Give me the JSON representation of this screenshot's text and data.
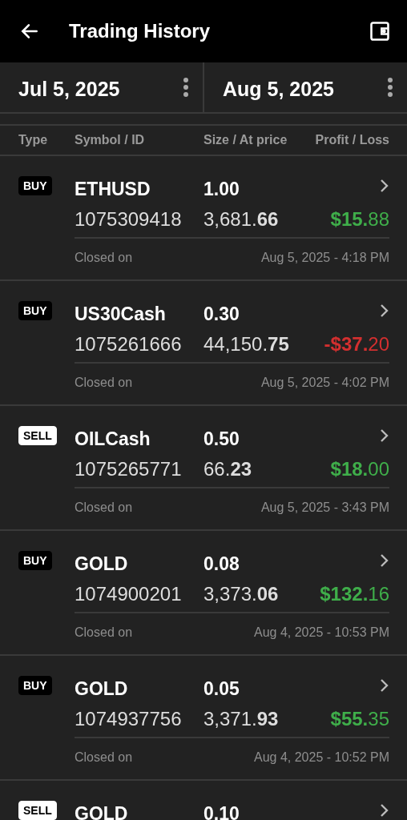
{
  "header": {
    "title": "Trading History"
  },
  "date_range": [
    {
      "value": "Jul 5, 2025"
    },
    {
      "value": "Aug 5, 2025"
    }
  ],
  "table": {
    "columns": [
      "Type",
      "Symbol / ID",
      "Size / At price",
      "Profit / Loss"
    ],
    "rows": [
      {
        "side": "BUY",
        "kind": "buy",
        "symbol": "ETHUSD",
        "size": "1.00",
        "id": "1075309418",
        "price": "3,681.**66**",
        "pnl": "**$15.**88",
        "color": "#3fae4a",
        "closed_label": "Closed on",
        "closed_at": "Aug 5, 2025 - 4:18 PM"
      },
      {
        "side": "BUY",
        "kind": "buy",
        "symbol": "US30Cash",
        "size": "0.30",
        "id": "1075261666",
        "price": "44,150.**75**",
        "pnl": "**-$37.**20",
        "color": "#d32f2f",
        "closed_label": "Closed on",
        "closed_at": "Aug 5, 2025 - 4:02 PM"
      },
      {
        "side": "SELL",
        "kind": "sell",
        "symbol": "OILCash",
        "size": "0.50",
        "id": "1075265771",
        "price": "66.**23**",
        "pnl": "**$18.**00",
        "color": "#3fae4a",
        "closed_label": "Closed on",
        "closed_at": "Aug 5, 2025 - 3:43 PM"
      },
      {
        "side": "BUY",
        "kind": "buy",
        "symbol": "GOLD",
        "size": "0.08",
        "id": "1074900201",
        "price": "3,373.**06**",
        "pnl": "**$132.**16",
        "color": "#3fae4a",
        "closed_label": "Closed on",
        "closed_at": "Aug 4, 2025 - 10:53 PM"
      },
      {
        "side": "BUY",
        "kind": "buy",
        "symbol": "GOLD",
        "size": "0.05",
        "id": "1074937756",
        "price": "3,371.**93**",
        "pnl": "**$55.**35",
        "color": "#3fae4a",
        "closed_label": "Closed on",
        "closed_at": "Aug 4, 2025 - 10:52 PM"
      },
      {
        "side": "SELL",
        "kind": "sell",
        "symbol": "GOLD",
        "size": "0.10"
      }
    ]
  }
}
